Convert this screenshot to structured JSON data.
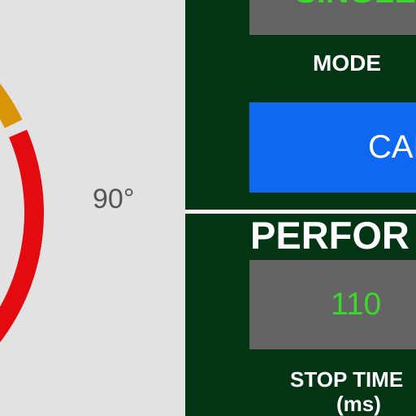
{
  "gauge": {
    "angle_label": "90°",
    "arc_colors": [
      "#d99408",
      "#e30a10"
    ]
  },
  "panel": {
    "top_value": "SINGLE",
    "mode_label": "MODE",
    "calibrate_button": "CAL",
    "section_title": "PERFOR",
    "stop_time_value": "110",
    "stop_time_label": "STOP TIME",
    "stop_time_unit": "(ms)"
  },
  "colors": {
    "panel_bg": "#033414",
    "accent_blue": "#0e68f2",
    "value_green": "#3ed62e",
    "box_gray": "#646464"
  }
}
